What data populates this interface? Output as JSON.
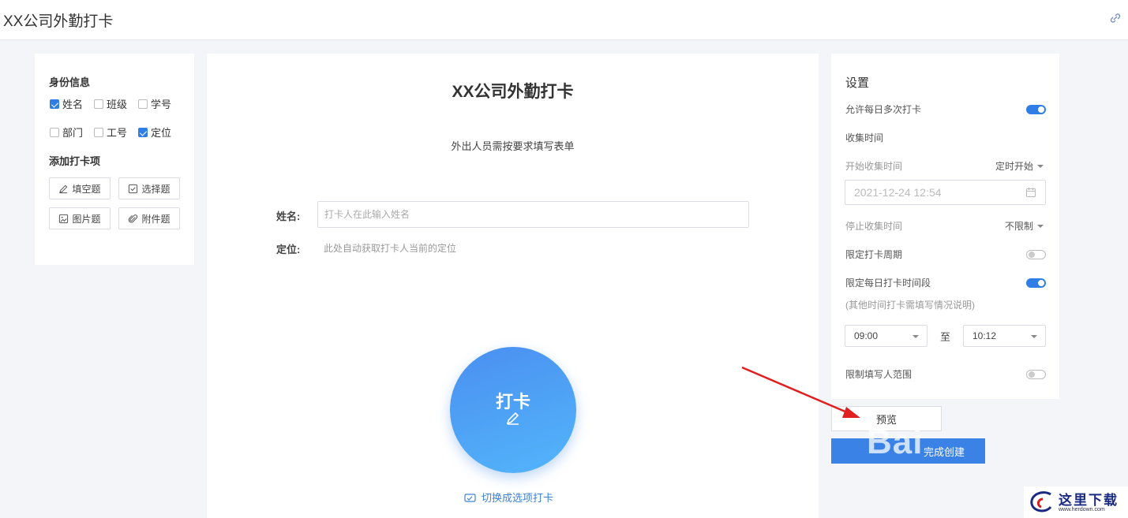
{
  "app": {
    "title": "XX公司外勤打卡"
  },
  "left": {
    "identity_title": "身份信息",
    "checkboxes": [
      {
        "label": "姓名",
        "checked": true
      },
      {
        "label": "班级",
        "checked": false
      },
      {
        "label": "学号",
        "checked": false
      },
      {
        "label": "部门",
        "checked": false
      },
      {
        "label": "工号",
        "checked": false
      },
      {
        "label": "定位",
        "checked": true
      }
    ],
    "add_title": "添加打卡项",
    "buttons": [
      {
        "label": "填空题",
        "icon": "pencil-icon"
      },
      {
        "label": "选择题",
        "icon": "checkbox-icon"
      },
      {
        "label": "图片题",
        "icon": "image-icon"
      },
      {
        "label": "附件题",
        "icon": "paperclip-icon"
      }
    ]
  },
  "form": {
    "title": "XX公司外勤打卡",
    "subtitle": "外出人员需按要求填写表单",
    "name_label": "姓名:",
    "name_placeholder": "打卡人在此输入姓名",
    "location_label": "定位:",
    "location_hint": "此处自动获取打卡人当前的定位",
    "punch_label": "打卡",
    "switch_label": "切换成选项打卡"
  },
  "settings": {
    "title": "设置",
    "allow_multiple": {
      "label": "允许每日多次打卡",
      "on": true
    },
    "collect_time": "收集时间",
    "start_label": "开始收集时间",
    "start_mode": "定时开始",
    "start_datetime": "2021-12-24 12:54",
    "stop_label": "停止收集时间",
    "stop_mode": "不限制",
    "limit_cycle": {
      "label": "限定打卡周期",
      "on": false
    },
    "limit_daily": {
      "label": "限定每日打卡时间段",
      "on": true
    },
    "daily_note": "(其他时间打卡需填写情况说明)",
    "time_from": "09:00",
    "to_label": "至",
    "time_to": "10:12",
    "limit_range": {
      "label": "限制填写人范围",
      "on": false
    }
  },
  "actions": {
    "preview": "预览",
    "create": "完成创建"
  },
  "overlay": {
    "watermark": "Bai",
    "site_logo": "这里下载",
    "site_url": "www.herdown.com"
  },
  "colors": {
    "accent": "#2f7ee6",
    "button_blue": "#3b82e6",
    "arrow": "#e02020"
  }
}
